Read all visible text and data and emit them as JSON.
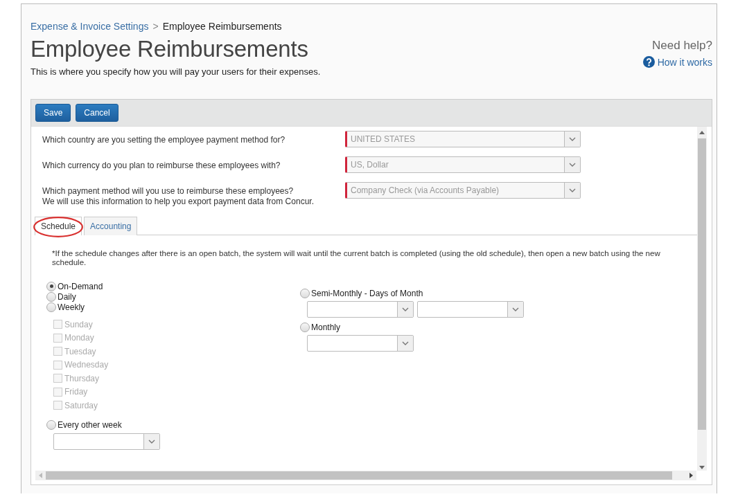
{
  "breadcrumb": {
    "parent": "Expense & Invoice Settings",
    "separator": ">",
    "current": "Employee Reimbursements"
  },
  "title": "Employee Reimbursements",
  "subtitle": "This is where you specify how you will pay your users for their expenses.",
  "help": {
    "heading": "Need help?",
    "link": "How it works"
  },
  "buttons": [
    "Save",
    "Cancel"
  ],
  "questions": [
    {
      "lines": [
        "Which country are you setting the employee payment method for?"
      ],
      "value": "UNITED STATES",
      "required": true
    },
    {
      "lines": [
        "Which currency do you plan to reimburse these employees with?"
      ],
      "value": "US, Dollar",
      "required": true
    },
    {
      "lines": [
        "Which payment method will you use to reimburse these employees?",
        "We will use this information to help you export payment data from Concur."
      ],
      "value": "Company Check (via Accounts Payable)",
      "required": true
    }
  ],
  "tabs": [
    {
      "label": "Schedule",
      "selected": true,
      "circled": true
    },
    {
      "label": "Accounting",
      "selected": false,
      "circled": false
    }
  ],
  "note": "*If the schedule changes after there is an open batch, the system will wait until the current batch is completed (using the old schedule), then open a new batch using the new schedule.",
  "left_options": [
    {
      "kind": "radio",
      "label": "On-Demand",
      "selected": true
    },
    {
      "kind": "radio",
      "label": "Daily",
      "selected": false
    },
    {
      "kind": "radio",
      "label": "Weekly",
      "selected": false
    },
    {
      "kind": "days",
      "days": [
        {
          "label": "Sunday",
          "checked": false,
          "disabled": true
        },
        {
          "label": "Monday",
          "checked": false,
          "disabled": true
        },
        {
          "label": "Tuesday",
          "checked": false,
          "disabled": true
        },
        {
          "label": "Wednesday",
          "checked": false,
          "disabled": true
        },
        {
          "label": "Thursday",
          "checked": false,
          "disabled": true
        },
        {
          "label": "Friday",
          "checked": false,
          "disabled": true
        },
        {
          "label": "Saturday",
          "checked": false,
          "disabled": true
        }
      ]
    },
    {
      "kind": "radio-select",
      "label": "Every other week",
      "selected": false
    }
  ],
  "right_options": [
    {
      "kind": "radio-two-selects",
      "label": "Semi-Monthly - Days of Month",
      "selected": false
    },
    {
      "kind": "radio-select",
      "label": "Monthly",
      "selected": false
    }
  ]
}
